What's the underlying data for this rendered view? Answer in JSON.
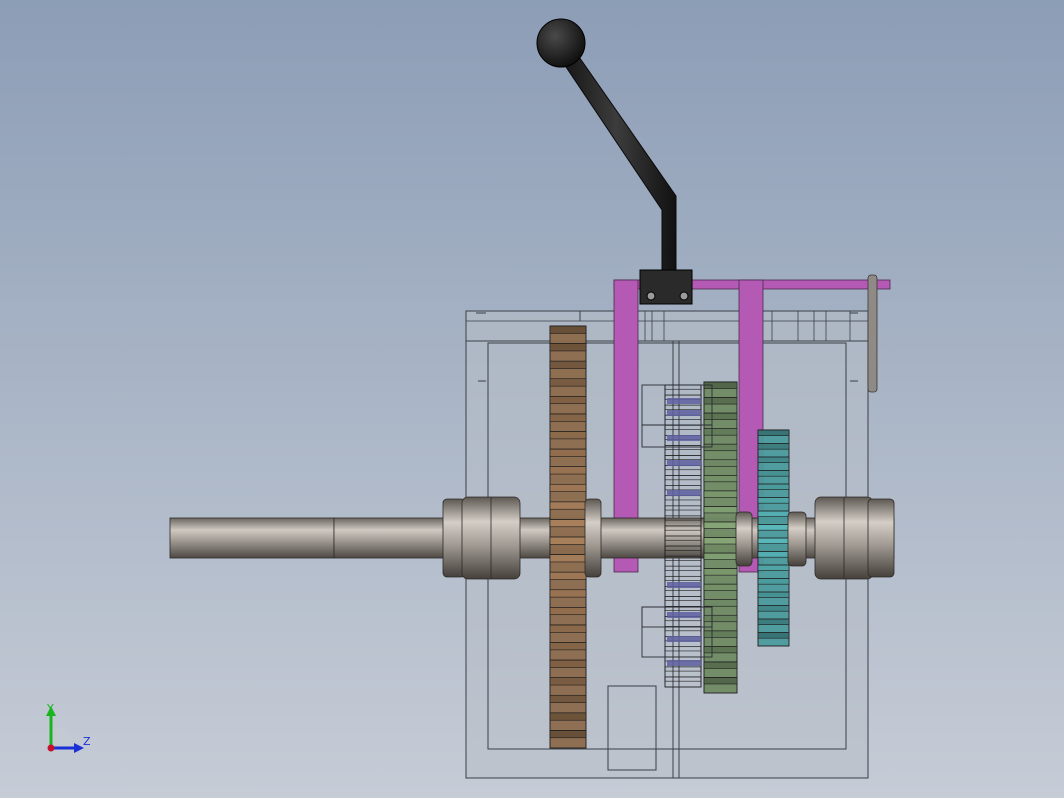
{
  "triad": {
    "y_label": "Y",
    "z_label": "Z",
    "y_color": "#19b51e",
    "z_color": "#1a2fd6",
    "origin_color": "#c8102e"
  },
  "colors": {
    "housing_line": "#3a3f47",
    "housing_fill": "#b9bfc9",
    "shaft": "#9a9590",
    "lever": "#1e1e1e",
    "fork": "#b45ab4",
    "gear_bronze": "#8c6a4c",
    "gear_blue": "#5e5fa0",
    "gear_green": "#6f8a63",
    "gear_teal": "#4b9a9c"
  }
}
